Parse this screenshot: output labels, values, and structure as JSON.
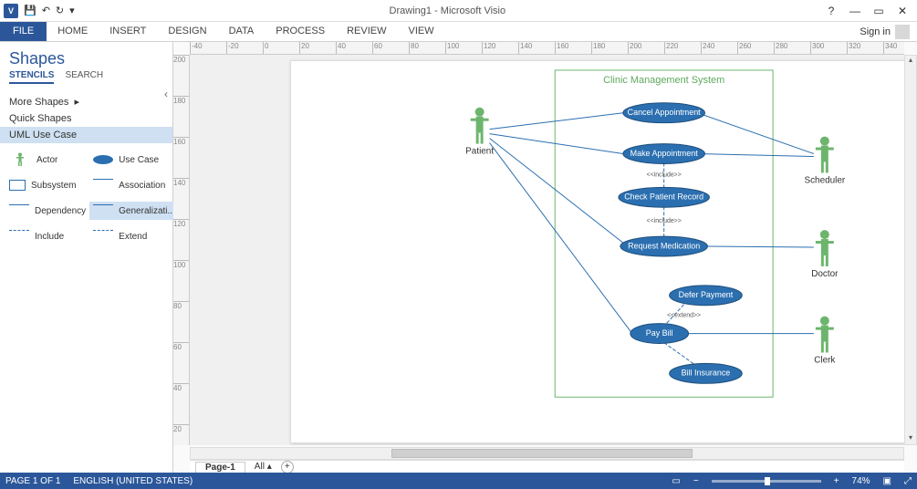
{
  "qat": {
    "app_abbrev": "V",
    "save_icon": "💾",
    "undo_icon": "↶",
    "redo_icon": "↻",
    "dropdown_icon": "▾"
  },
  "title": "Drawing1 - Microsoft Visio",
  "window": {
    "help": "?",
    "min": "—",
    "restore": "▭",
    "close": "✕"
  },
  "ribbon": {
    "file": "FILE",
    "tabs": [
      "HOME",
      "INSERT",
      "DESIGN",
      "DATA",
      "PROCESS",
      "REVIEW",
      "VIEW"
    ],
    "signin": "Sign in"
  },
  "shapes": {
    "title": "Shapes",
    "tab_stencils": "STENCILS",
    "tab_search": "SEARCH",
    "more": "More Shapes",
    "quick": "Quick Shapes",
    "uml": "UML Use Case",
    "items": {
      "actor": "Actor",
      "usecase": "Use Case",
      "subsystem": "Subsystem",
      "association": "Association",
      "dependency": "Dependency",
      "generalization": "Generalizati...",
      "include": "Include",
      "extend": "Extend"
    },
    "collapse": "‹"
  },
  "ruler_h": [
    "-40",
    "-20",
    "0",
    "20",
    "40",
    "60",
    "80",
    "100",
    "120",
    "140",
    "160",
    "180",
    "200",
    "220",
    "240",
    "260",
    "280",
    "300",
    "320",
    "340"
  ],
  "ruler_v": [
    "200",
    "180",
    "160",
    "140",
    "120",
    "100",
    "80",
    "60",
    "40",
    "20"
  ],
  "diagram": {
    "system": "Clinic Management System",
    "actors": {
      "patient": "Patient",
      "scheduler": "Scheduler",
      "doctor": "Doctor",
      "clerk": "Clerk"
    },
    "usecases": {
      "cancel": "Cancel Appointment",
      "make": "Make Appointment",
      "check": "Check Patient Record",
      "request": "Request Medication",
      "defer": "Defer Payment",
      "pay": "Pay Bill",
      "bill": "Bill Insurance"
    },
    "stereo": {
      "include": "<<include>>",
      "extend": "<<extend>>"
    }
  },
  "page_tabs": {
    "page": "Page-1",
    "all": "All",
    "all_arrow": "▴",
    "add": "+"
  },
  "status": {
    "page": "PAGE 1 OF 1",
    "lang": "ENGLISH (UNITED STATES)",
    "zoom": "74%"
  }
}
